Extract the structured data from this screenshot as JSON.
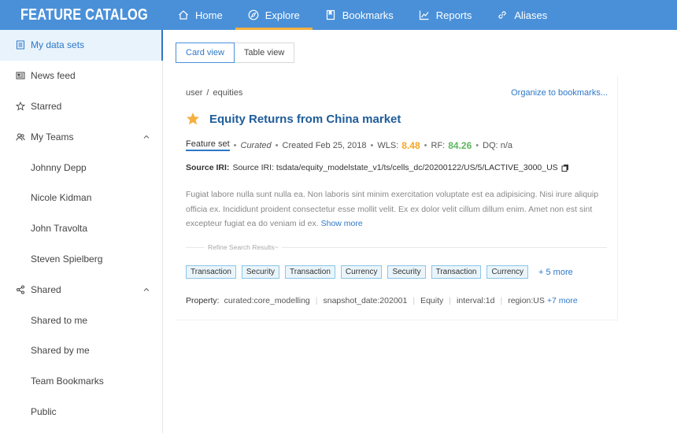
{
  "app": {
    "name": "FEATURE CATALOG",
    "logo_icon": "cube-grid-icon"
  },
  "nav": [
    {
      "label": "Home",
      "icon": "home-icon",
      "active": false
    },
    {
      "label": "Explore",
      "icon": "compass-icon",
      "active": true
    },
    {
      "label": "Bookmarks",
      "icon": "bookmark-icon",
      "active": false
    },
    {
      "label": "Reports",
      "icon": "chart-icon",
      "active": false
    },
    {
      "label": "Aliases",
      "icon": "link-icon",
      "active": false
    }
  ],
  "sidebar": {
    "items": [
      {
        "label": "My data sets",
        "icon": "database-icon",
        "active": true
      },
      {
        "label": "News feed",
        "icon": "newspaper-icon"
      },
      {
        "label": "Starred",
        "icon": "star-outline-icon"
      },
      {
        "label": "My Teams",
        "icon": "team-icon",
        "expanded": true
      },
      {
        "label": "Johnny Depp",
        "sub": true
      },
      {
        "label": "Nicole Kidman",
        "sub": true
      },
      {
        "label": "John Travolta",
        "sub": true
      },
      {
        "label": "Steven Spielberg",
        "sub": true
      },
      {
        "label": "Shared",
        "icon": "share-icon",
        "expanded": true
      },
      {
        "label": "Shared to me",
        "sub": true
      },
      {
        "label": "Shared by me",
        "sub": true
      },
      {
        "label": "Team Bookmarks",
        "sub": true
      },
      {
        "label": "Public",
        "sub": true
      }
    ]
  },
  "view_toggle": {
    "card": "Card view",
    "table": "Table view",
    "selected": "card"
  },
  "card": {
    "breadcrumb": [
      "user",
      "equities"
    ],
    "breadcrumb_sep": "/",
    "organize_link": "Organize to bookmarks...",
    "starred": true,
    "title": "Equity Returns from China market",
    "meta": {
      "type": "Feature set",
      "status": "Curated",
      "created": "Created Feb 25, 2018",
      "wls_label": "WLS:",
      "wls_value": "8.48",
      "rf_label": "RF:",
      "rf_value": "84.26",
      "dq": "DQ: n/a"
    },
    "source": {
      "label": "Source IRI:",
      "value": "Source IRI: tsdata/equity_modelstate_v1/ts/cells_dc/20200122/US/5/LACTIVE_3000_US"
    },
    "description": "Fugiat labore nulla sunt nulla ea. Non laboris sint minim exercitation voluptate est ea adipisicing. Nisi irure aliquip officia ex. Incididunt proident consectetur esse mollit velit. Ex ex dolor velit cillum dillum enim. Amet non est sint excepteur fugiat ea do veniam id ex.",
    "show_more": "Show more",
    "refine_label": "Refine Search Results~",
    "tags": [
      "Transaction",
      "Security",
      "Transaction",
      "Currency",
      "Security",
      "Transaction",
      "Currency"
    ],
    "tags_more": "+ 5 more",
    "properties": {
      "label": "Property:",
      "values": [
        "curated:core_modelling",
        "snapshot_date:202001",
        "Equity",
        "interval:1d",
        "region:US"
      ],
      "more": "+7 more"
    }
  }
}
